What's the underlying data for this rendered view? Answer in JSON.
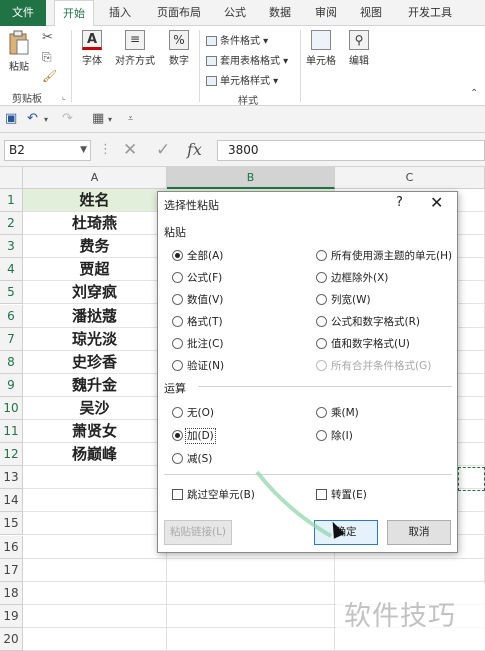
{
  "ribbon_tabs": [
    "文件",
    "开始",
    "插入",
    "页面布局",
    "公式",
    "数据",
    "审阅",
    "视图",
    "开发工具"
  ],
  "ribbon": {
    "paste": "粘贴",
    "clipboard_group": "剪贴板",
    "font": "字体",
    "alignment": "对齐方式",
    "number": "数字",
    "number_symbol": "%",
    "conditional_format": "条件格式",
    "table_format": "套用表格格式",
    "cell_styles": "单元格样式",
    "styles_group": "样式",
    "cells": "单元格",
    "editing": "编辑"
  },
  "name_box": "B2",
  "formula_value": "3800",
  "fx_label": "fx",
  "columns": [
    "A",
    "B",
    "C"
  ],
  "rows": [
    "1",
    "2",
    "3",
    "4",
    "5",
    "6",
    "7",
    "8",
    "9",
    "10",
    "11",
    "12",
    "13",
    "14",
    "15",
    "16",
    "17",
    "18",
    "19",
    "20"
  ],
  "column_a": [
    "姓名",
    "杜琦燕",
    "费务",
    "贾超",
    "刘穿疯",
    "潘挞蔻",
    "琼光淡",
    "史珍香",
    "魏升金",
    "吴沙",
    "萧贤女",
    "杨巅峰"
  ],
  "dialog": {
    "title": "选择性粘贴",
    "help": "?",
    "paste_section": "粘贴",
    "paste_left": [
      "全部(A)",
      "公式(F)",
      "数值(V)",
      "格式(T)",
      "批注(C)",
      "验证(N)"
    ],
    "paste_right": [
      "所有使用源主题的单元(H)",
      "边框除外(X)",
      "列宽(W)",
      "公式和数字格式(R)",
      "值和数字格式(U)",
      "所有合并条件格式(G)"
    ],
    "paste_selected": "全部(A)",
    "operation_section": "运算",
    "op_left": [
      "无(O)",
      "加(D)",
      "减(S)"
    ],
    "op_right": [
      "乘(M)",
      "除(I)"
    ],
    "operation_selected": "加(D)",
    "skip_blanks": "跳过空单元(B)",
    "transpose": "转置(E)",
    "paste_link": "粘贴链接(L)",
    "ok": "确定",
    "cancel": "取消"
  },
  "watermark": "软件技巧"
}
